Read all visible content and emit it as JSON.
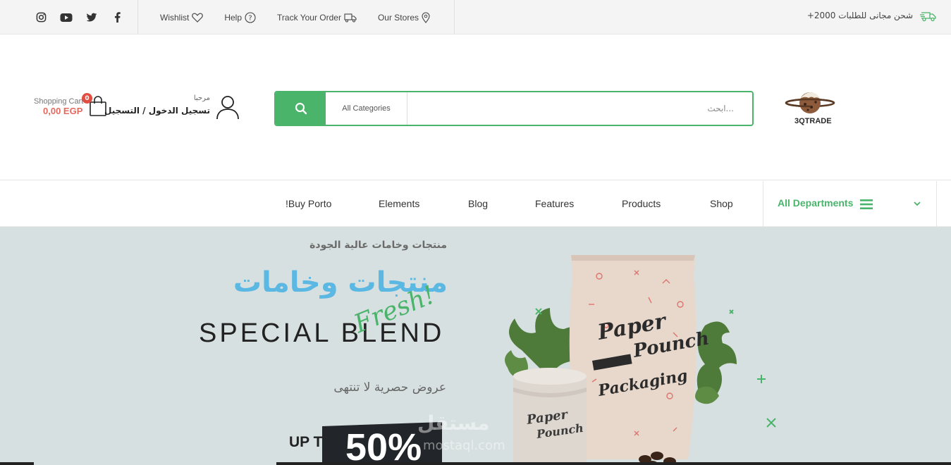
{
  "topbar": {
    "social_icons": [
      "instagram-icon",
      "youtube-icon",
      "twitter-icon",
      "facebook-icon"
    ],
    "links": [
      {
        "label": "Wishlist",
        "icon": "heart-icon"
      },
      {
        "label": "Help",
        "icon": "question-circle-icon"
      },
      {
        "label": "Track Your Order",
        "icon": "truck-icon"
      },
      {
        "label": "Our Stores",
        "icon": "map-pin-icon"
      }
    ],
    "shipping_text": "شحن مجانى للطلبات 2000+"
  },
  "header": {
    "cart": {
      "label": "Shopping Cart",
      "price": "0,00 EGP",
      "count": "0"
    },
    "account": {
      "greeting": "مرحبا",
      "login": "تسجيل الدخول / التسجيل"
    },
    "search": {
      "placeholder": "ابحث...",
      "category": "All Categories"
    },
    "logo_text": "3QTRADE"
  },
  "nav": {
    "items": [
      "!Buy Porto",
      "Elements",
      "Blog",
      "Features",
      "Products",
      "Shop"
    ],
    "departments": "All Departments"
  },
  "hero": {
    "eyebrow": "منتجات وخامات عالية الجودة",
    "headline": "منتجات وخامات",
    "blend": "SPECIAL BLEND",
    "fresh": "Fresh!",
    "offers": "عروض حصرية لا تنتهى",
    "upto": "UP T",
    "percent": "50%",
    "watermark": "مستقل",
    "watermark_url": "mostaql.com"
  },
  "colors": {
    "accent": "#4ab46b",
    "sky": "#5bb8e3",
    "price": "#e26a5e",
    "badge": "#e14d43",
    "hero_bg": "#d7e0e0"
  }
}
